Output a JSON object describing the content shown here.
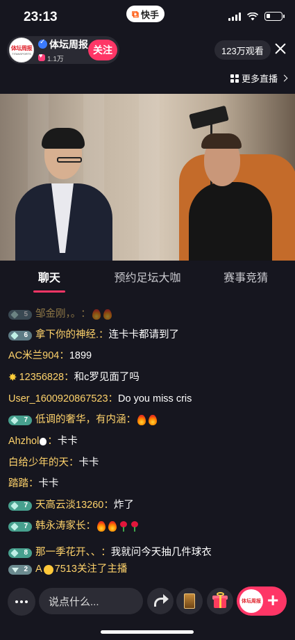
{
  "status_bar": {
    "time": "23:13",
    "app_name": "快手"
  },
  "anchor": {
    "logo_text": "体坛周报",
    "logo_subtext": "TITANSPORTS",
    "name": "体坛周报",
    "likes": "1.1万",
    "follow_label": "关注"
  },
  "viewers": "123万观看",
  "more_live_label": "更多直播",
  "tabs": [
    {
      "label": "聊天",
      "active": true
    },
    {
      "label": "预约足坛大咖",
      "active": false
    },
    {
      "label": "赛事竞猜",
      "active": false
    }
  ],
  "chat": {
    "messages": [
      {
        "level": "5",
        "user": "邹金刚，。",
        "sep": "：",
        "content": ""
      },
      {
        "level": "6",
        "user": "拿下你的神经.",
        "sep": "：",
        "content": "连卡卡都请到了"
      },
      {
        "user": "AC米兰904",
        "sep": "：",
        "content": "1899"
      },
      {
        "user": "12356828",
        "sep": "：",
        "content": "和c罗见面了吗"
      },
      {
        "user": "User_1600920867523",
        "sep": "：",
        "content": "Do you miss cris"
      },
      {
        "level": "7",
        "user": "低调的奢华，有内涵",
        "sep": "：",
        "content": ""
      },
      {
        "user": "Ahzhol",
        "sep": "：",
        "content": "卡卡"
      },
      {
        "user": "白给少年的天",
        "sep": "：",
        "content": "卡卡"
      },
      {
        "user": "踏踏",
        "sep": "：",
        "content": "卡卡"
      },
      {
        "level": "7",
        "user": "天高云淡13260",
        "sep": "：",
        "content": "炸了"
      },
      {
        "level": "7",
        "user": "韩永涛家长",
        "sep": "：",
        "content": ""
      },
      {
        "level": "8",
        "user": "那一季花开、、",
        "sep": "：",
        "content": "我就问今天抽几件球衣"
      }
    ],
    "follow_notice": {
      "level": "2",
      "user_prefix": "A",
      "user_suffix": "7513",
      "action": " 关注了主播"
    }
  },
  "bottom_bar": {
    "input_placeholder": "说点什么...",
    "anchor_logo_text": "体坛周报"
  },
  "icons": {
    "more": "more-dots-icon",
    "share": "share-arrow-icon",
    "card": "card-icon",
    "gift": "gift-icon",
    "plus": "plus-icon",
    "close": "close-icon"
  },
  "colors": {
    "accent": "#fe3666",
    "username": "#ffd36b",
    "background": "#16161f"
  }
}
